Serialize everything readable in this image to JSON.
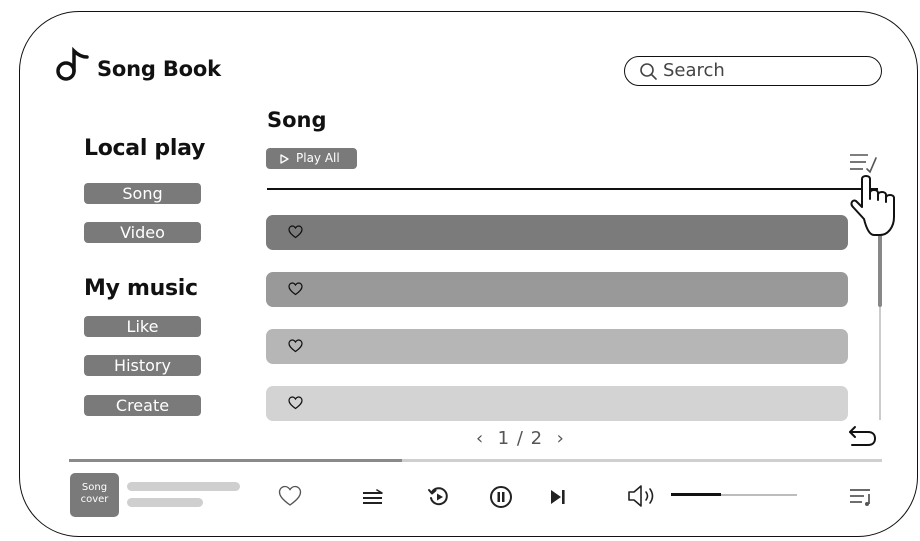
{
  "app": {
    "title": "Song Book",
    "logo_icon": "music-note-icon"
  },
  "search": {
    "placeholder": "Search"
  },
  "sidebar": {
    "local_play": {
      "heading": "Local play",
      "items": [
        {
          "label": "Song"
        },
        {
          "label": "Video"
        }
      ]
    },
    "my_music": {
      "heading": "My music",
      "items": [
        {
          "label": "Like"
        },
        {
          "label": "History"
        },
        {
          "label": "Create"
        }
      ]
    }
  },
  "main": {
    "title": "Song",
    "play_all_label": "Play All",
    "rows": [
      {
        "color": "#7b7b7b",
        "liked": false
      },
      {
        "color": "#999999",
        "liked": false
      },
      {
        "color": "#b6b6b6",
        "liked": false
      },
      {
        "color": "#d3d3d3",
        "liked": false
      }
    ],
    "pagination": {
      "current": "1",
      "separator": "/",
      "total": "2"
    }
  },
  "player": {
    "cover_label_line1": "Song",
    "cover_label_line2": "cover",
    "progress": 0.41,
    "volume": 0.4,
    "controls": [
      "heart-icon",
      "playlist-icon",
      "replay-icon",
      "pause-icon",
      "skip-next-icon",
      "volume-icon",
      "queue-icon"
    ]
  },
  "colors": {
    "accent": "#7a7a7a",
    "text": "#111111",
    "track": "#cfcfcf"
  }
}
